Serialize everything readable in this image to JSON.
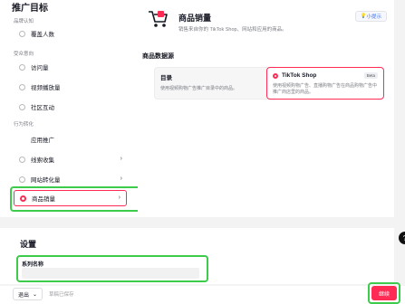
{
  "left": {
    "title": "推广目标",
    "groups": [
      {
        "label": "品牌认知"
      },
      {
        "label": "受众意向"
      },
      {
        "label": "行为转化"
      }
    ],
    "options": [
      {
        "label": "覆盖人数"
      },
      {
        "label": "访问量"
      },
      {
        "label": "视频播放量"
      },
      {
        "label": "社区互动"
      },
      {
        "label": "应用推广"
      },
      {
        "label": "线索收集"
      },
      {
        "label": "网站转化量"
      },
      {
        "label": "商品销量"
      }
    ]
  },
  "right": {
    "title": "商品销量",
    "description": "销售来自你的 TikTok Shop、网站和应用的商品。",
    "guide_label": "小提示",
    "source_title": "商品数据源",
    "cards": [
      {
        "title": "目录",
        "desc": "使用视频购物广告推广目录中的商品。"
      },
      {
        "title": "TikTok Shop",
        "badge": "Beta",
        "desc": "使用视频购物广告、直播购物广告在商品购物广告中推广商店里的商品。"
      }
    ]
  },
  "settings": {
    "title": "设置",
    "series_label": "系列名称"
  },
  "bottom": {
    "exit_label": "退出",
    "saved_label": "草稿已保存",
    "continue_label": "继续"
  },
  "colors": {
    "accent": "#fe2c55",
    "highlight": "#3ccb4a"
  }
}
